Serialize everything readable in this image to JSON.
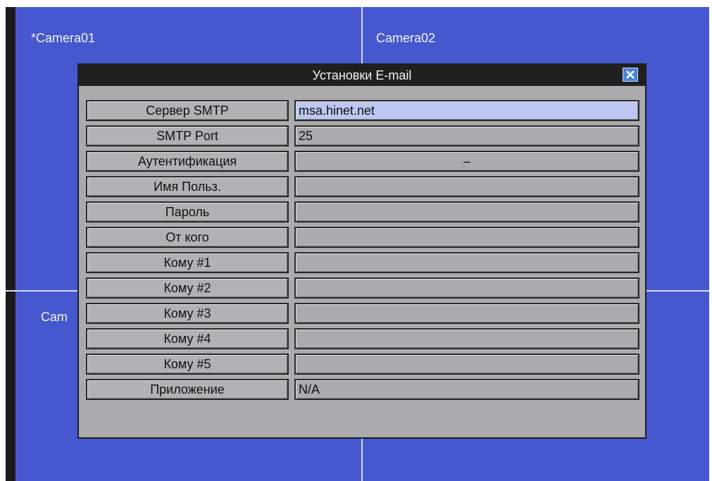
{
  "cameras": {
    "cam1": "*Camera01",
    "cam2": "Camera02",
    "cam3": "Cam"
  },
  "dialog": {
    "title": "Установки E-mail",
    "close_icon": "close-x-icon",
    "fields": [
      {
        "label": "Сервер SMTP",
        "value": "msa.hinet.net"
      },
      {
        "label": "SMTP Port",
        "value": "25"
      },
      {
        "label": "Аутентификация",
        "value": "–"
      },
      {
        "label": "Имя Польз.",
        "value": ""
      },
      {
        "label": "Пароль",
        "value": ""
      },
      {
        "label": "От кого",
        "value": ""
      },
      {
        "label": "Кому #1",
        "value": ""
      },
      {
        "label": "Кому #2",
        "value": ""
      },
      {
        "label": "Кому #3",
        "value": ""
      },
      {
        "label": "Кому #4",
        "value": ""
      },
      {
        "label": "Кому #5",
        "value": ""
      },
      {
        "label": "Приложение",
        "value": "N/A"
      }
    ]
  },
  "colors": {
    "background": "#4757cf",
    "dialog": "#a9abad",
    "title_bar": "#202020",
    "selected_field": "#bcc8f2",
    "close_button": "#4a86d6"
  }
}
